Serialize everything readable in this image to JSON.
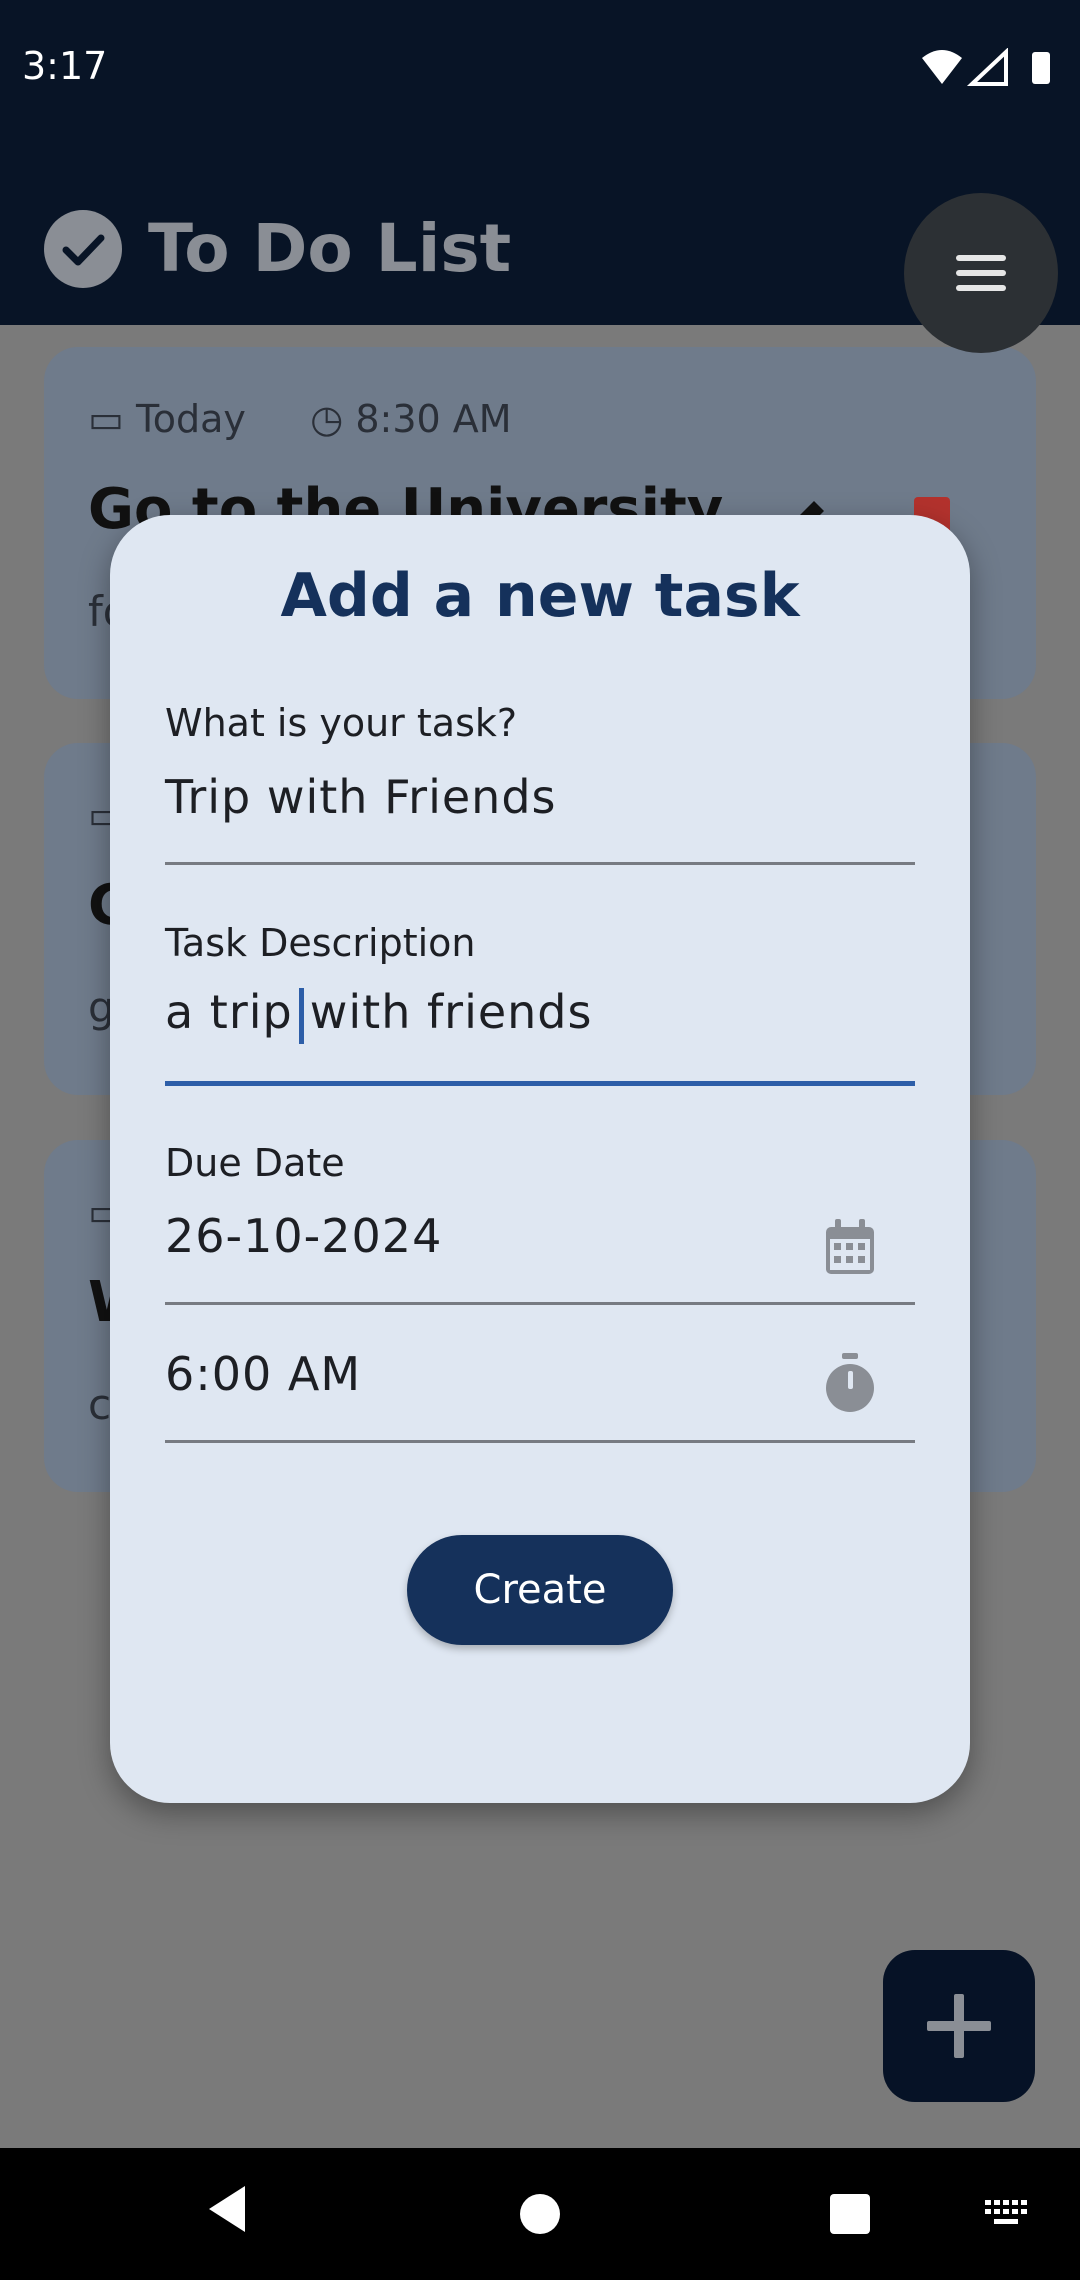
{
  "status_bar": {
    "time": "3:17"
  },
  "app_bar": {
    "title": "To Do List"
  },
  "background_cards": [
    {
      "date": "Today",
      "time": "8:30 AM",
      "title": "Go to the University",
      "description": "fo"
    },
    {
      "date": "",
      "time": "",
      "title": "G",
      "description": "g"
    },
    {
      "date": "",
      "time": "",
      "title": "W",
      "description": "c"
    }
  ],
  "dialog": {
    "title": "Add a new task",
    "task_label": "What is your task?",
    "task_value": "Trip with Friends",
    "description_label": "Task Description",
    "description_before_caret": "a trip",
    "description_after_caret": "with friends",
    "due_date_label": "Due Date",
    "due_date_value": "26-10-2024",
    "time_value": "6:00 AM",
    "create_label": "Create"
  },
  "colors": {
    "app_bar": "#081426",
    "dialog_bg": "#dfe7f2",
    "primary": "#15315b",
    "focus": "#2d5ea8",
    "delete_icon": "#b3322d"
  },
  "icons": {
    "logo": "check-circle-icon",
    "menu": "hamburger-menu-icon",
    "calendar": "calendar-icon",
    "timer": "stopwatch-icon",
    "add": "plus-icon"
  }
}
